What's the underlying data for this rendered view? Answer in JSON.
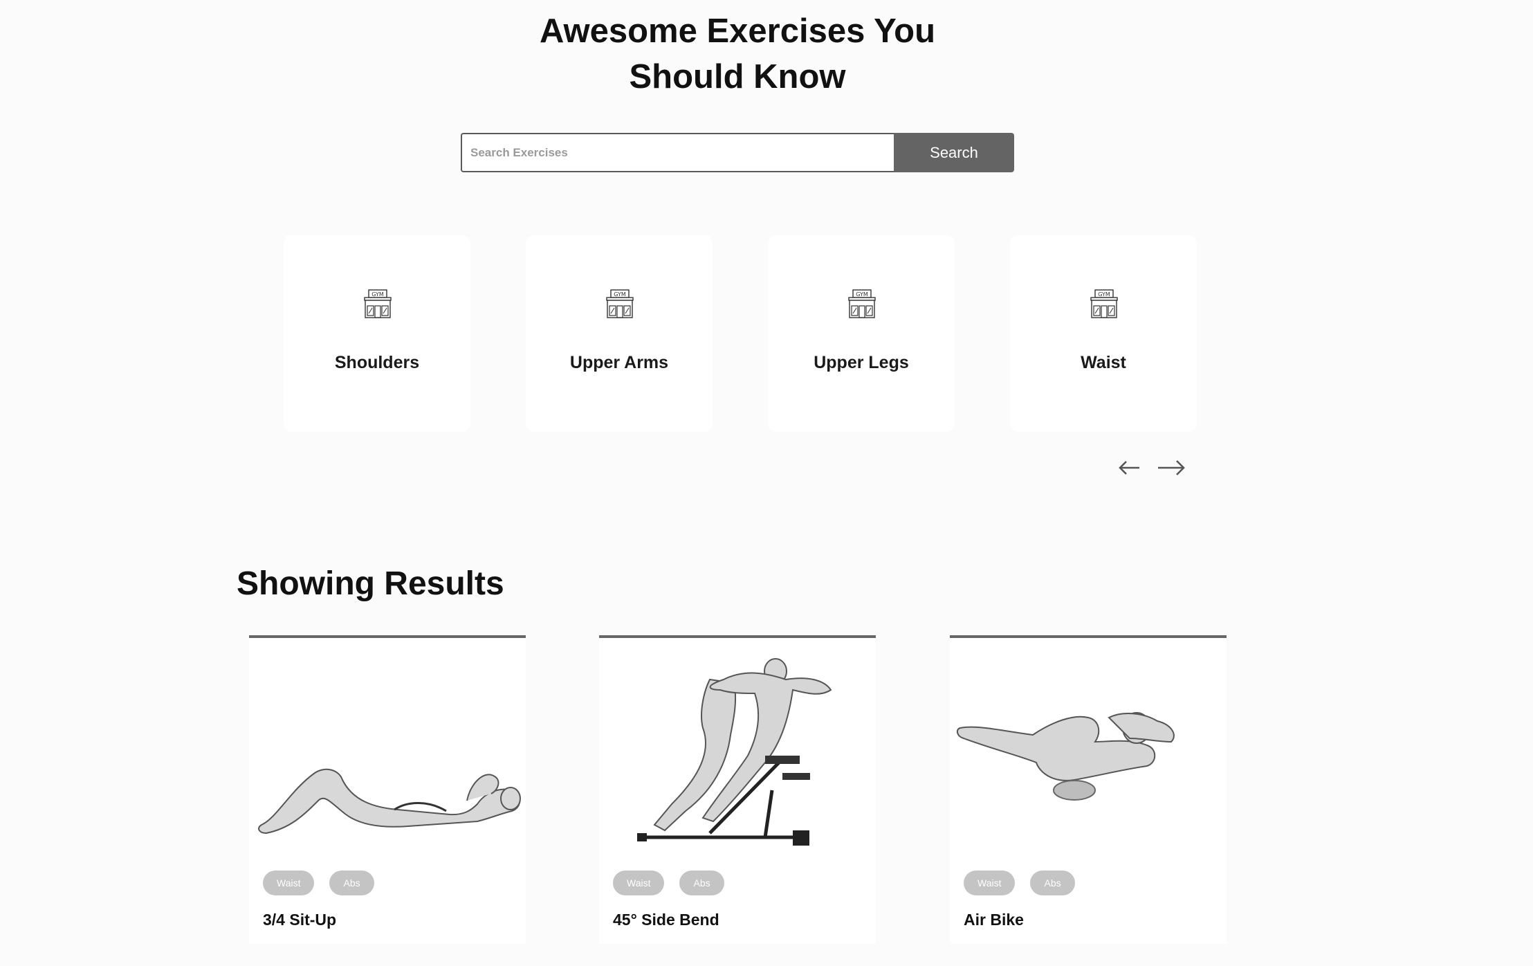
{
  "hero": {
    "title_line1": "Awesome Exercises You",
    "title_line2": "Should Know"
  },
  "search": {
    "placeholder": "Search Exercises",
    "value": "",
    "button_label": "Search"
  },
  "categories": {
    "items": [
      {
        "label": "Shoulders",
        "icon": "gym-icon"
      },
      {
        "label": "Upper Arms",
        "icon": "gym-icon"
      },
      {
        "label": "Upper Legs",
        "icon": "gym-icon"
      },
      {
        "label": "Waist",
        "icon": "gym-icon"
      }
    ],
    "icon_text": "GYM",
    "prev_icon": "arrow-left-icon",
    "next_icon": "arrow-right-icon"
  },
  "results": {
    "title": "Showing Results",
    "exercises": [
      {
        "name": "3/4 Sit-Up",
        "tags": [
          "Waist",
          "Abs"
        ]
      },
      {
        "name": "45° Side Bend",
        "tags": [
          "Waist",
          "Abs"
        ]
      },
      {
        "name": "Air Bike",
        "tags": [
          "Waist",
          "Abs"
        ]
      }
    ]
  },
  "colors": {
    "background": "#fbfbfb",
    "search_button": "#646464",
    "tag": "#c4c4c4",
    "card_border": "#666666"
  }
}
